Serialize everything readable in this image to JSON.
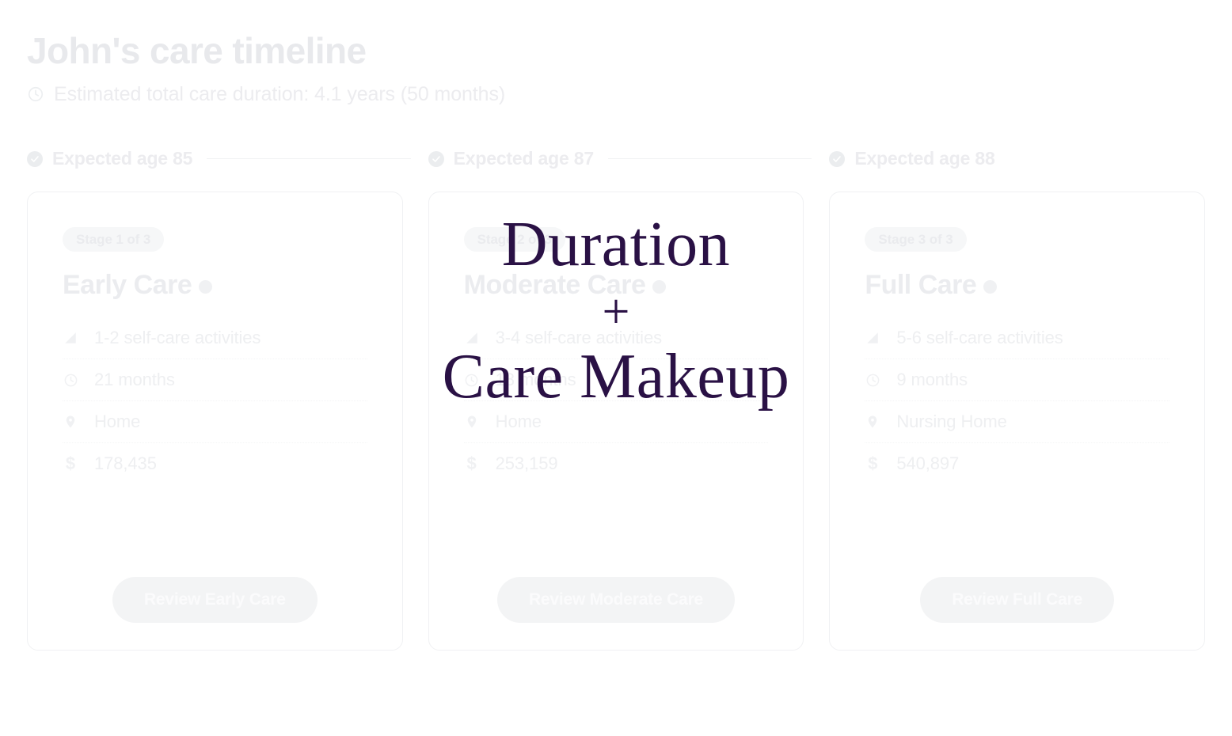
{
  "header": {
    "title": "John's care timeline",
    "duration_icon": "clock-icon",
    "subtitle": "Estimated total care duration: 4.1 years (50 months)"
  },
  "overlay": {
    "line1": "Duration",
    "plus": "+",
    "line2": "Care Makeup",
    "color": "#2a1145"
  },
  "colors": {
    "accent": "#2a1145",
    "card_border": "#f0f1f3",
    "muted_text": "#ebecef",
    "pill_bg": "#f6f7f8",
    "button_bg": "#f3f4f5"
  },
  "timeline": {
    "stages": [
      {
        "age_icon": "check-circle-icon",
        "age_label": "Expected age 85",
        "stage_badge": "Stage 1 of 3",
        "title": "Early Care",
        "help_icon": "help-circle-icon",
        "details": [
          {
            "icon": "signal-bars-icon",
            "value": "1-2 self-care activities"
          },
          {
            "icon": "clock-icon",
            "value": "21 months"
          },
          {
            "icon": "map-pin-icon",
            "value": "Home"
          },
          {
            "icon": "dollar-icon",
            "value": "178,435"
          }
        ],
        "button": "Review Early Care"
      },
      {
        "age_icon": "check-circle-icon",
        "age_label": "Expected age 87",
        "stage_badge": "Stage 2 of 3",
        "title": "Moderate Care",
        "help_icon": "help-circle-icon",
        "details": [
          {
            "icon": "signal-bars-icon",
            "value": "3-4 self-care activities"
          },
          {
            "icon": "clock-icon",
            "value": "18 months"
          },
          {
            "icon": "map-pin-icon",
            "value": "Home"
          },
          {
            "icon": "dollar-icon",
            "value": "253,159"
          }
        ],
        "button": "Review Moderate Care"
      },
      {
        "age_icon": "check-circle-icon",
        "age_label": "Expected age 88",
        "stage_badge": "Stage 3 of 3",
        "title": "Full Care",
        "help_icon": "help-circle-icon",
        "details": [
          {
            "icon": "signal-bars-icon",
            "value": "5-6 self-care activities"
          },
          {
            "icon": "clock-icon",
            "value": "9 months"
          },
          {
            "icon": "map-pin-icon",
            "value": "Nursing Home"
          },
          {
            "icon": "dollar-icon",
            "value": "540,897"
          }
        ],
        "button": "Review Full Care"
      }
    ]
  }
}
